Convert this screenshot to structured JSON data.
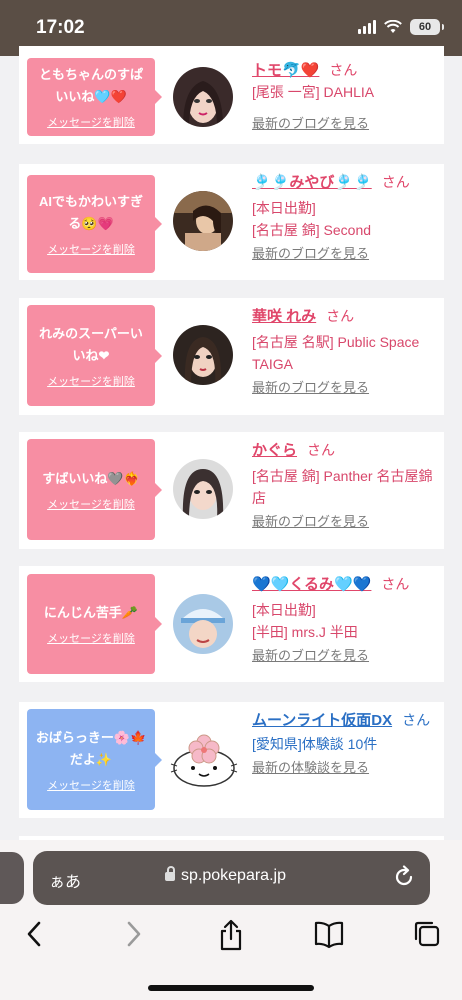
{
  "status": {
    "time": "17:02",
    "battery": "60"
  },
  "cards": [
    {
      "message": "ともちゃんのすぱいいね🩵❤️",
      "delete": "メッセージを削除",
      "name": "トモ🐬❤️",
      "san": "さん",
      "lines": [
        "[尾張 一宮] DAHLIA"
      ],
      "link": "最新のブログを見る"
    },
    {
      "message": "AIでもかわいすぎる🥺💗",
      "delete": "メッセージを削除",
      "name": "🎐🎐みやび🎐🎐",
      "san": "さん",
      "lines": [
        "[本日出勤]",
        "[名古屋 錦] Second"
      ],
      "link": "最新のブログを見る"
    },
    {
      "message": "れみのスーパーいいね❤︎",
      "delete": "メッセージを削除",
      "name": "華咲 れみ",
      "san": "さん",
      "lines": [
        "[名古屋 名駅] Public Space TAIGA"
      ],
      "link": "最新のブログを見る"
    },
    {
      "message": "すばいいね🩶❤️‍🔥",
      "delete": "メッセージを削除",
      "name": "かぐら",
      "san": "さん",
      "lines": [
        "[名古屋 錦] Panther 名古屋錦店"
      ],
      "link": "最新のブログを見る"
    },
    {
      "message": "にんじん苦手🥕",
      "delete": "メッセージを削除",
      "name": "💙🩵くるみ🩵💙",
      "san": "さん",
      "lines": [
        "[本日出勤]",
        "[半田] mrs.J 半田"
      ],
      "link": "最新のブログを見る"
    },
    {
      "message": "おばらっきー🌸🍁だよ✨",
      "delete": "メッセージを削除",
      "name": "ムーンライト仮面DX",
      "san": "さん",
      "lines": [
        "[愛知県]体験談 10件"
      ],
      "link": "最新の体験談を見る"
    }
  ],
  "browser": {
    "aa": "ぁあ",
    "url": "sp.pokepara.jp"
  },
  "icons": {
    "back": "back-icon",
    "forward": "forward-icon",
    "share": "share-icon",
    "bookmarks": "bookmarks-icon",
    "tabs": "tabs-icon",
    "reload": "reload-icon",
    "lock": "lock-icon"
  }
}
